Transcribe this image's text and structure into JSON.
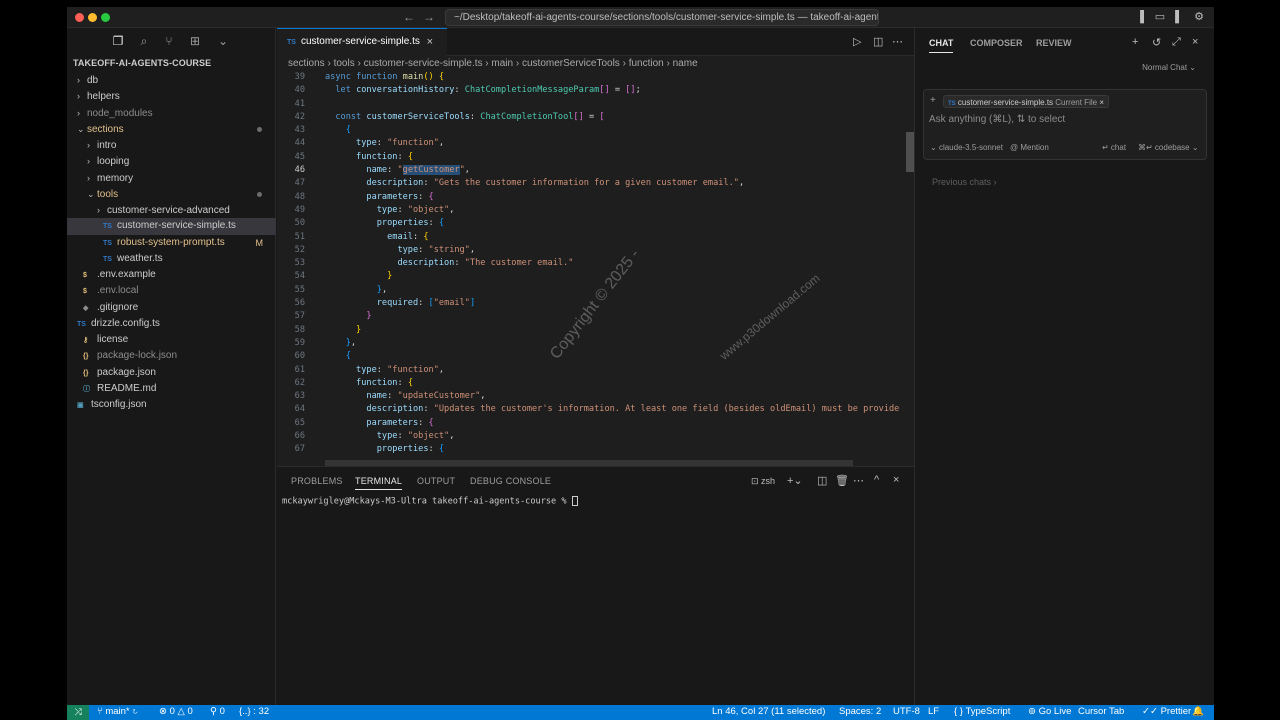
{
  "titlebar": {
    "path": "~/Desktop/takeoff-ai-agents-course/sections/tools/customer-service-simple.ts — takeoff-ai-agents-..."
  },
  "sidebar": {
    "title": "TAKEOFF-AI-AGENTS-COURSE",
    "items": [
      {
        "label": "db",
        "chev": "›",
        "icon": "",
        "indent": 0,
        "cls": ""
      },
      {
        "label": "helpers",
        "chev": "›",
        "icon": "",
        "indent": 0,
        "cls": ""
      },
      {
        "label": "node_modules",
        "chev": "›",
        "icon": "",
        "indent": 0,
        "cls": "dim"
      },
      {
        "label": "sections",
        "chev": "⌄",
        "icon": "",
        "indent": 0,
        "cls": "mod",
        "dot": true
      },
      {
        "label": "intro",
        "chev": "›",
        "icon": "",
        "indent": 1,
        "cls": ""
      },
      {
        "label": "looping",
        "chev": "›",
        "icon": "",
        "indent": 1,
        "cls": ""
      },
      {
        "label": "memory",
        "chev": "›",
        "icon": "",
        "indent": 1,
        "cls": ""
      },
      {
        "label": "tools",
        "chev": "⌄",
        "icon": "",
        "indent": 1,
        "cls": "mod",
        "dot": true
      },
      {
        "label": "customer-service-advanced",
        "chev": "›",
        "icon": "",
        "indent": 2,
        "cls": ""
      },
      {
        "label": "customer-service-simple.ts",
        "chev": "",
        "icon": "TS",
        "indent": 2,
        "cls": "",
        "active": true
      },
      {
        "label": "robust-system-prompt.ts",
        "chev": "",
        "icon": "TS",
        "indent": 2,
        "cls": "mod",
        "badge": "M"
      },
      {
        "label": "weather.ts",
        "chev": "",
        "icon": "TS",
        "indent": 2,
        "cls": ""
      },
      {
        "label": ".env.example",
        "chev": "",
        "icon": "$",
        "indent": 0,
        "cls": ""
      },
      {
        "label": ".env.local",
        "chev": "",
        "icon": "$",
        "indent": 0,
        "cls": "dim"
      },
      {
        "label": ".gitignore",
        "chev": "",
        "icon": "◆",
        "indent": 0,
        "cls": ""
      },
      {
        "label": "drizzle.config.ts",
        "chev": "",
        "icon": "TS",
        "indent": -1,
        "cls": ""
      },
      {
        "label": "license",
        "chev": "",
        "icon": "⚷",
        "indent": 0,
        "cls": ""
      },
      {
        "label": "package-lock.json",
        "chev": "",
        "icon": "{}",
        "indent": 0,
        "cls": "dim"
      },
      {
        "label": "package.json",
        "chev": "",
        "icon": "{}",
        "indent": 0,
        "cls": ""
      },
      {
        "label": "README.md",
        "chev": "",
        "icon": "ⓘ",
        "indent": 0,
        "cls": ""
      },
      {
        "label": "tsconfig.json",
        "chev": "",
        "icon": "▣",
        "indent": -1,
        "cls": ""
      }
    ]
  },
  "editor": {
    "tab_label": "customer-service-simple.ts",
    "tab_icon": "TS",
    "breadcrumb": [
      "sections",
      "tools",
      "customer-service-simple.ts",
      "main",
      "customerServiceTools",
      "function",
      "name"
    ],
    "current_line": 46,
    "lines": [
      {
        "n": 39,
        "html": "<span class='k'>async</span> <span class='k'>function</span> <span class='f'>main</span><span class='b1'>()</span> <span class='b1'>{</span>"
      },
      {
        "n": 40,
        "html": "  <span class='k'>let</span> <span class='v'>conversationHistory</span><span class='p'>:</span> <span class='t'>ChatCompletionMessageParam</span><span class='b2'>[]</span> <span class='p'>=</span> <span class='b2'>[]</span><span class='p'>;</span>"
      },
      {
        "n": 41,
        "html": ""
      },
      {
        "n": 42,
        "html": "  <span class='k'>const</span> <span class='v'>customerServiceTools</span><span class='p'>:</span> <span class='t'>ChatCompletionTool</span><span class='b2'>[]</span> <span class='p'>=</span> <span class='b2'>[</span>"
      },
      {
        "n": 43,
        "html": "    <span class='b3'>{</span>"
      },
      {
        "n": 44,
        "html": "      <span class='v'>type</span><span class='p'>:</span> <span class='s'>\"function\"</span><span class='p'>,</span>"
      },
      {
        "n": 45,
        "html": "      <span class='v'>function</span><span class='p'>:</span> <span class='b1'>{</span>"
      },
      {
        "n": 46,
        "html": "        <span class='v'>name</span><span class='p'>:</span> <span class='s'>\"<span class='sel'>getCustomer</span>\"</span><span class='p'>,</span>"
      },
      {
        "n": 47,
        "html": "        <span class='v'>description</span><span class='p'>:</span> <span class='s'>\"Gets the customer information for a given customer email.\"</span><span class='p'>,</span>"
      },
      {
        "n": 48,
        "html": "        <span class='v'>parameters</span><span class='p'>:</span> <span class='b2'>{</span>"
      },
      {
        "n": 49,
        "html": "          <span class='v'>type</span><span class='p'>:</span> <span class='s'>\"object\"</span><span class='p'>,</span>"
      },
      {
        "n": 50,
        "html": "          <span class='v'>properties</span><span class='p'>:</span> <span class='b3'>{</span>"
      },
      {
        "n": 51,
        "html": "            <span class='v'>email</span><span class='p'>:</span> <span class='b1'>{</span>"
      },
      {
        "n": 52,
        "html": "              <span class='v'>type</span><span class='p'>:</span> <span class='s'>\"string\"</span><span class='p'>,</span>"
      },
      {
        "n": 53,
        "html": "              <span class='v'>description</span><span class='p'>:</span> <span class='s'>\"The customer email.\"</span>"
      },
      {
        "n": 54,
        "html": "            <span class='b1'>}</span>"
      },
      {
        "n": 55,
        "html": "          <span class='b3'>}</span><span class='p'>,</span>"
      },
      {
        "n": 56,
        "html": "          <span class='v'>required</span><span class='p'>:</span> <span class='b3'>[</span><span class='s'>\"email\"</span><span class='b3'>]</span>"
      },
      {
        "n": 57,
        "html": "        <span class='b2'>}</span>"
      },
      {
        "n": 58,
        "html": "      <span class='b1'>}</span>"
      },
      {
        "n": 59,
        "html": "    <span class='b3'>}</span><span class='p'>,</span>"
      },
      {
        "n": 60,
        "html": "    <span class='b3'>{</span>"
      },
      {
        "n": 61,
        "html": "      <span class='v'>type</span><span class='p'>:</span> <span class='s'>\"function\"</span><span class='p'>,</span>"
      },
      {
        "n": 62,
        "html": "      <span class='v'>function</span><span class='p'>:</span> <span class='b1'>{</span>"
      },
      {
        "n": 63,
        "html": "        <span class='v'>name</span><span class='p'>:</span> <span class='s'>\"updateCustomer\"</span><span class='p'>,</span>"
      },
      {
        "n": 64,
        "html": "        <span class='v'>description</span><span class='p'>:</span> <span class='s'>\"Updates the customer's information. At least one field (besides oldEmail) must be provide</span>"
      },
      {
        "n": 65,
        "html": "        <span class='v'>parameters</span><span class='p'>:</span> <span class='b2'>{</span>"
      },
      {
        "n": 66,
        "html": "          <span class='v'>type</span><span class='p'>:</span> <span class='s'>\"object\"</span><span class='p'>,</span>"
      },
      {
        "n": 67,
        "html": "          <span class='v'>properties</span><span class='p'>:</span> <span class='b3'>{</span>"
      }
    ]
  },
  "panel": {
    "tabs": [
      "PROBLEMS",
      "TERMINAL",
      "OUTPUT",
      "DEBUG CONSOLE"
    ],
    "active_tab": "TERMINAL",
    "shell": "zsh",
    "prompt": "mckaywrigley@Mckays-M3-Ultra takeoff-ai-agents-course % "
  },
  "chat": {
    "tabs": [
      "CHAT",
      "COMPOSER",
      "REVIEW"
    ],
    "mode": "Normal Chat",
    "context_file": "customer-service-simple.ts",
    "context_tag": "Current File",
    "placeholder": "Ask anything (⌘L), ⇅ to select",
    "model": "claude-3.5-sonnet",
    "mention": "@ Mention",
    "chat_action": "↵ chat",
    "codebase_action": "⌘↵ codebase",
    "previous_chats": "Previous chats"
  },
  "statusbar": {
    "branch": "main*",
    "errors": "0",
    "warnings": "0",
    "ports": "0",
    "braces": "{..} : 32",
    "position": "Ln 46, Col 27 (11 selected)",
    "spaces": "Spaces: 2",
    "encoding": "UTF-8",
    "eol": "LF",
    "language": "TypeScript",
    "golive": "Go Live",
    "cursor_tab": "Cursor Tab",
    "prettier": "Prettier"
  },
  "watermark": {
    "text1": "Copyright © 2025 -",
    "text2": "www.p30download.com"
  },
  "colors": {
    "accent": "#0078d4",
    "editor_bg": "#1e1e1e",
    "sidebar_bg": "#181818"
  }
}
